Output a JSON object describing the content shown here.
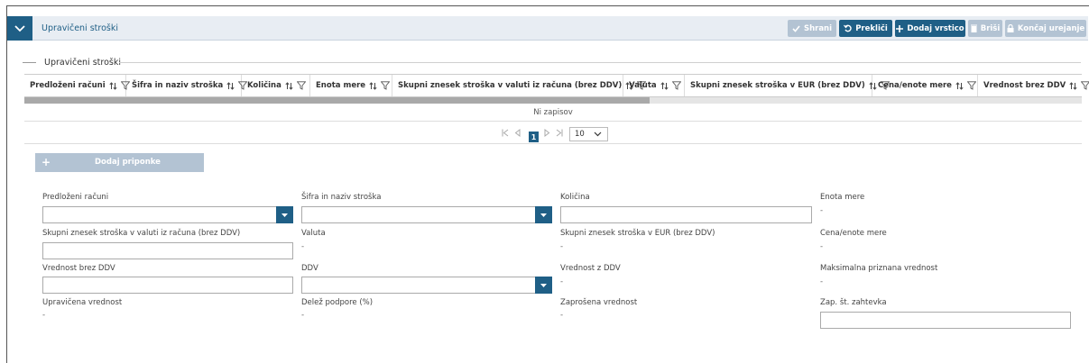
{
  "header": {
    "title": "Upravičeni stroški",
    "buttons": {
      "save": "Shrani",
      "cancel": "Prekliči",
      "add_row": "Dodaj vrstico",
      "delete": "Briši",
      "finish": "Končaj urejanje"
    },
    "colors": {
      "accent": "#1f5f86",
      "disabled": "#b3c3d3",
      "header_bg": "#e8edf3"
    }
  },
  "section": {
    "title": "Upravičeni stroški"
  },
  "grid": {
    "columns": [
      "Predloženi računi",
      "Šifra in naziv stroška",
      "Količina",
      "Enota mere",
      "Skupni znesek stroška v valuti iz računa (brez DDV)",
      "Valuta",
      "Skupni znesek stroška v EUR (brez DDV)",
      "Cena/enote mere",
      "Vrednost brez DDV"
    ],
    "empty_text": "Ni zapisov",
    "pager": {
      "current_page": "1",
      "page_size": "10"
    }
  },
  "attachments": {
    "add_label": "Dodaj priponke",
    "add_symbol": "+"
  },
  "form": {
    "predlozeni_racuni": {
      "label": "Predloženi računi",
      "value": ""
    },
    "sifra_naziv": {
      "label": "Šifra in naziv stroška",
      "value": ""
    },
    "kolicina": {
      "label": "Količina",
      "value": ""
    },
    "enota_mere": {
      "label": "Enota mere",
      "value": "-"
    },
    "skupni_valuta": {
      "label": "Skupni znesek stroška v valuti iz računa (brez DDV)",
      "value": ""
    },
    "valuta": {
      "label": "Valuta",
      "value": "-"
    },
    "skupni_eur": {
      "label": "Skupni znesek stroška v EUR (brez DDV)",
      "value": "-"
    },
    "cena_enote": {
      "label": "Cena/enote mere",
      "value": "-"
    },
    "vrednost_brez_ddv": {
      "label": "Vrednost brez DDV",
      "value": ""
    },
    "ddv": {
      "label": "DDV",
      "value": ""
    },
    "vrednost_z_ddv": {
      "label": "Vrednost z DDV",
      "value": "-"
    },
    "maks_priznana": {
      "label": "Maksimalna priznana vrednost",
      "value": "-"
    },
    "upravicena": {
      "label": "Upravičena vrednost",
      "value": "-"
    },
    "delez_podpore": {
      "label": "Delež podpore (%)",
      "value": "-"
    },
    "zaprosena": {
      "label": "Zaprošena vrednost",
      "value": "-"
    },
    "zap_st_zahtevka": {
      "label": "Zap. št. zahtevka",
      "value": ""
    }
  }
}
